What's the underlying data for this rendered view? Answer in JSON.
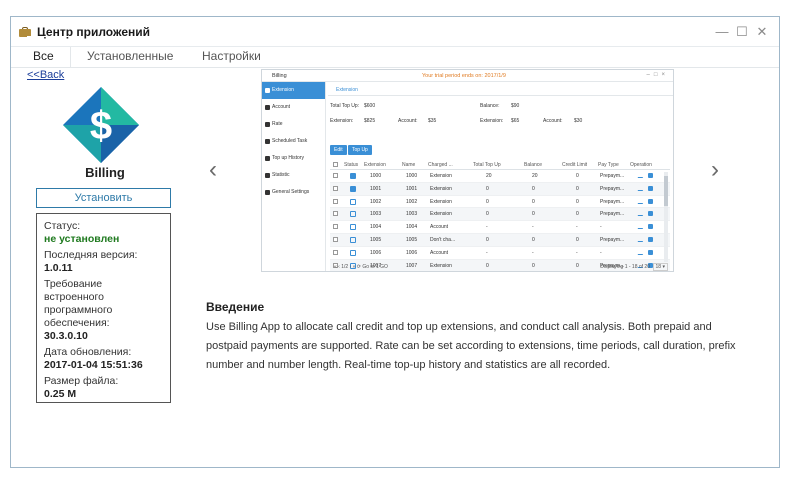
{
  "window": {
    "title": "Центр приложений",
    "controls": [
      "—",
      "☐",
      "✕"
    ]
  },
  "tabs": [
    {
      "label": "Все",
      "active": true
    },
    {
      "label": "Установленные",
      "active": false
    },
    {
      "label": "Настройки",
      "active": false
    }
  ],
  "back_link": "<<Back",
  "app": {
    "name": "Billing",
    "install_label": "Установить",
    "logo_icon": "billing-dollar-icon",
    "logo_colors": [
      "#1ea3a8",
      "#1b75bc",
      "#23b9a2"
    ]
  },
  "info": {
    "status_label": "Статус:",
    "status_value": "не установлен",
    "latest_version_label": "Последняя версия:",
    "latest_version_value": "1.0.11",
    "firmware_label": "Требование встроенного программного обеспечения:",
    "firmware_value": "30.3.0.10",
    "update_date_label": "Дата обновления:",
    "update_date_value": "2017-01-04 15:51:36",
    "file_size_label": "Размер файла:",
    "file_size_value": "0.25 M"
  },
  "nav": {
    "prev": "‹",
    "next": "›"
  },
  "screenshot": {
    "title": "Billing",
    "trial": "Your trial period ends on: 2017/1/9",
    "sidebar": [
      {
        "label": "Extension",
        "active": true
      },
      {
        "label": "Account",
        "active": false
      },
      {
        "label": "Rate",
        "active": false
      },
      {
        "label": "Scheduled Task",
        "active": false
      },
      {
        "label": "Top up History",
        "active": false
      },
      {
        "label": "Statistic",
        "active": false
      },
      {
        "label": "General Settings",
        "active": false
      }
    ],
    "tab": "Extension",
    "summary": {
      "total_top_up_label": "Total Top Up:",
      "total_top_up_value": "$600",
      "balance_label_1": "Balance:",
      "balance_value_1": "$90",
      "extension_label": "Extension:",
      "extension_value": "$825",
      "account_label": "Account:",
      "account_value": "$35",
      "extension_label_2": "Extension:",
      "extension_value_2": "$65",
      "account_label_2": "Account:",
      "account_value_2": "$30"
    },
    "buttons": {
      "edit": "Edit",
      "topup": "Top Up"
    },
    "columns": [
      "Status",
      "Extension",
      "Name",
      "Charged ...",
      "Total Top Up",
      "Balance",
      "Credit Limit",
      "Pay Type",
      "Operation"
    ],
    "rows": [
      {
        "locked": true,
        "ext": "1000",
        "name": "1000",
        "charged": "Extension",
        "topup": "20",
        "balance": "20",
        "limit": "0",
        "pay": "Prepaym..."
      },
      {
        "locked": true,
        "ext": "1001",
        "name": "1001",
        "charged": "Extension",
        "topup": "0",
        "balance": "0",
        "limit": "0",
        "pay": "Prepaym..."
      },
      {
        "locked": false,
        "ext": "1002",
        "name": "1002",
        "charged": "Extension",
        "topup": "0",
        "balance": "0",
        "limit": "0",
        "pay": "Prepaym..."
      },
      {
        "locked": false,
        "ext": "1003",
        "name": "1003",
        "charged": "Extension",
        "topup": "0",
        "balance": "0",
        "limit": "0",
        "pay": "Prepaym..."
      },
      {
        "locked": false,
        "ext": "1004",
        "name": "1004",
        "charged": "Account",
        "topup": "-",
        "balance": "-",
        "limit": "-",
        "pay": "-"
      },
      {
        "locked": false,
        "ext": "1005",
        "name": "1005",
        "charged": "Don't cha...",
        "topup": "0",
        "balance": "0",
        "limit": "0",
        "pay": "Prepaym..."
      },
      {
        "locked": false,
        "ext": "1006",
        "name": "1006",
        "charged": "Account",
        "topup": "-",
        "balance": "-",
        "limit": "-",
        "pay": "-"
      },
      {
        "locked": false,
        "ext": "1007",
        "name": "1007",
        "charged": "Extension",
        "topup": "0",
        "balance": "0",
        "limit": "0",
        "pay": "Prepaym..."
      }
    ],
    "footer": {
      "pager": "« ‹ 1/2 › » ⟳ Go to 1 GO",
      "displaying": "Displaying 1 - 18 of 20",
      "per_page": "18 ▾"
    }
  },
  "intro": {
    "title": "Введение",
    "text": "Use Billing App to allocate call credit and top up extensions, and conduct call analysis. Both prepaid and postpaid payments are supported. Rate can be set according to extensions, time periods, call duration, prefix number and number length. Real-time top-up history and statistics are all recorded."
  }
}
